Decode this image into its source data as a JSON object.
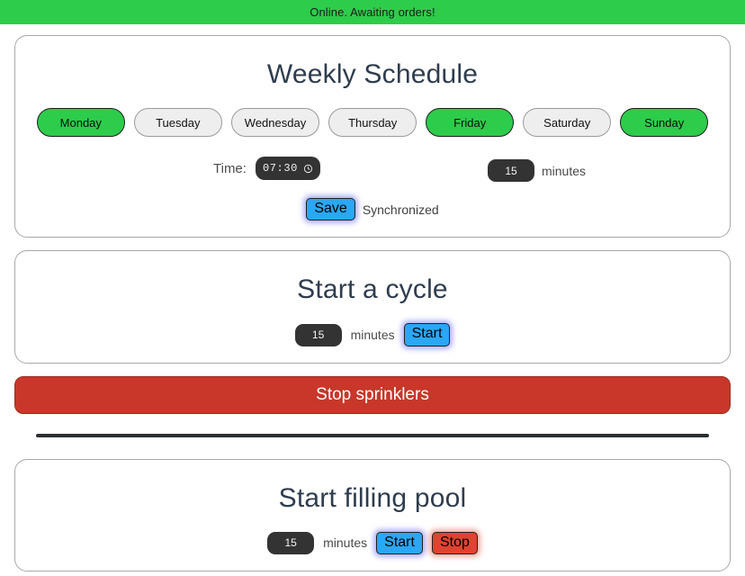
{
  "status_bar": {
    "text": "Online. Awaiting orders!",
    "color": "#2ecc4b"
  },
  "schedule_card": {
    "title": "Weekly Schedule",
    "days": [
      {
        "label": "Monday",
        "active": true
      },
      {
        "label": "Tuesday",
        "active": false
      },
      {
        "label": "Wednesday",
        "active": false
      },
      {
        "label": "Thursday",
        "active": false
      },
      {
        "label": "Friday",
        "active": true
      },
      {
        "label": "Saturday",
        "active": false
      },
      {
        "label": "Sunday",
        "active": true
      }
    ],
    "time_label": "Time:",
    "time_value": "07:30",
    "time_icon": "clock-icon",
    "duration_value": "15",
    "duration_unit": "minutes",
    "save_label": "Save",
    "sync_status": "Synchronized"
  },
  "cycle_card": {
    "title": "Start a cycle",
    "duration_value": "15",
    "duration_unit": "minutes",
    "start_label": "Start"
  },
  "stop_sprinklers": {
    "label": "Stop sprinklers",
    "color": "#c8372a"
  },
  "pool_card": {
    "title": "Start filling pool",
    "duration_value": "15",
    "duration_unit": "minutes",
    "start_label": "Start",
    "stop_label": "Stop"
  },
  "colors": {
    "accent_green": "#2ecc4b",
    "accent_blue": "#2aa7f5",
    "accent_red": "#e0432f",
    "heading": "#2f3d4f",
    "input_dark": "#333333"
  }
}
